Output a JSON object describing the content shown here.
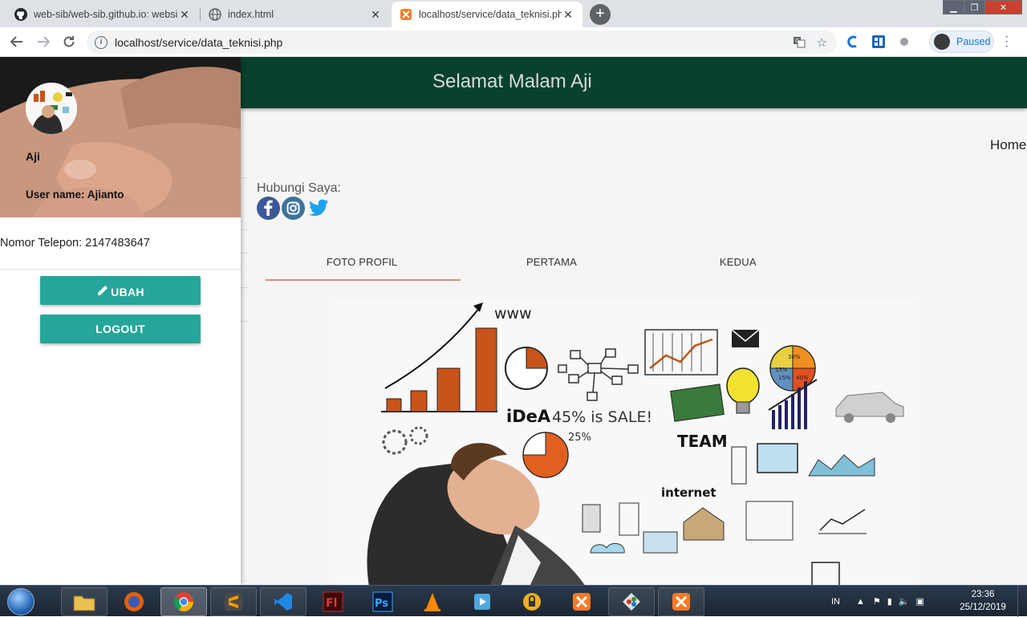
{
  "browser": {
    "tabs": [
      {
        "title": "web-sib/web-sib.github.io: websi",
        "icon": "github-icon"
      },
      {
        "title": "index.html",
        "icon": "globe-icon"
      },
      {
        "title": "localhost/service/data_teknisi.php",
        "icon": "xampp-icon"
      }
    ],
    "url": "localhost/service/data_teknisi.php",
    "profile_status": "Paused"
  },
  "header": {
    "greeting": "Selamat Malam Aji"
  },
  "nav": {
    "home": "Home"
  },
  "sidebar": {
    "name": "Aji",
    "username_line": "User name: Ajianto",
    "phone_line": "Nomor Telepon: 2147483647",
    "edit_button": "UBAH",
    "logout_button": "LOGOUT"
  },
  "contact": {
    "label": "Hubungi Saya:",
    "icons": [
      "facebook-icon",
      "instagram-icon",
      "twitter-icon"
    ]
  },
  "content_tabs": [
    {
      "label": "FOTO PROFIL",
      "active": true
    },
    {
      "label": "PERTAMA",
      "active": false
    },
    {
      "label": "KEDUA",
      "active": false
    }
  ],
  "hero_words": {
    "www": "www",
    "idea": "iDeA",
    "sale": "45% is SALE!",
    "team": "TEAM",
    "internet": "internet",
    "pct25": "25%",
    "pie_label_a": "30%",
    "pie_label_b": "15%",
    "pie_label_c": "15%",
    "pie_label_d": "40%"
  },
  "taskbar": {
    "lang": "IN",
    "time": "23:36",
    "date": "25/12/2019"
  },
  "colors": {
    "header_bg": "#09412f",
    "button_bg": "#26a69a",
    "tab_indicator": "#e08a78"
  }
}
